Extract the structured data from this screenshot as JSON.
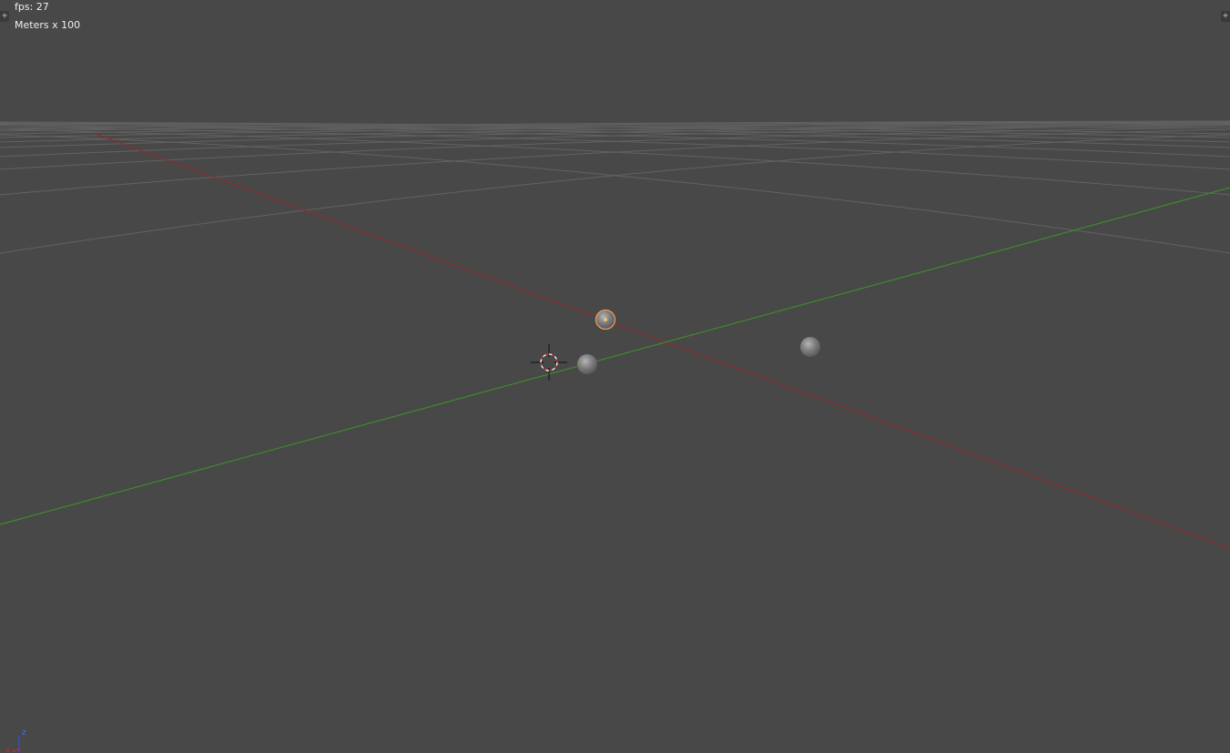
{
  "viewport": {
    "fps_text": "fps: 27",
    "units_text": "Meters x 100"
  },
  "region_toggles": {
    "left_glyph": "+",
    "right_glyph": "+"
  },
  "axis_gizmo": {
    "z_label": "z",
    "x_label": "x"
  },
  "colors": {
    "background": "#484848",
    "grid": "#5f5f5f",
    "x_axis": "#8a2e2e",
    "y_axis": "#3f8a2a",
    "z_axis": "#2f4fc8",
    "selection_outline": "#f0a060"
  },
  "icons": {
    "cursor": "3d-cursor-icon",
    "gizmo": "axis-gizmo-icon"
  }
}
